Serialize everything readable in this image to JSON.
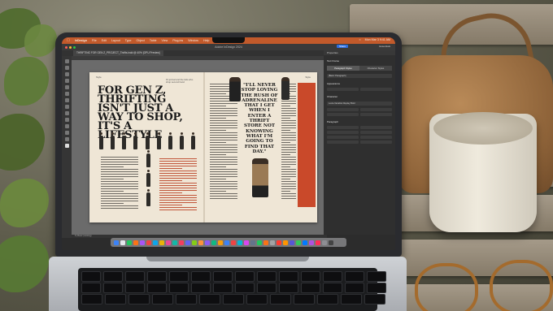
{
  "menubar": {
    "app_name": "InDesign",
    "items": [
      "File",
      "Edit",
      "Layout",
      "Type",
      "Object",
      "Table",
      "View",
      "Plug-ins",
      "Window",
      "Help"
    ],
    "status_time": "Mon Mar 3  9:41 AM"
  },
  "app": {
    "window_title": "Adobe InDesign 2024",
    "share_label": "Share",
    "workspace_label": "Essentials",
    "document_tab": "THRIFTING FOR GEN Z_PROJECT_Thrifts.indd @ 40% [GPU Preview]"
  },
  "spread": {
    "left_folio": "Style",
    "right_folio": "Style",
    "headline": "FOR GEN Z, THRIFTING ISN'T JUST A WAY TO SHOP, IT'S A LIFESTYLE",
    "byline": "Fit jotrnal and the kids who shop second hand",
    "pull_quote": "\"I'LL NEVER STOP LOVING THE RUSH OF ADRENALINE THAT I GET WHEN I ENTER A THRIFT STORE NOT KNOWING WHAT I'M GOING TO FIND THAT DAY.\""
  },
  "properties": {
    "panel_title": "Properties",
    "section_text_frame": "Text Frame",
    "tabs": [
      "Paragraph Styles",
      "Character Styles"
    ],
    "style_value": "[Basic Paragraph]",
    "section_appearance": "Appearance",
    "section_character": "Character",
    "font_value": "Lexia Variable Display Bold",
    "section_paragraph": "Paragraph"
  },
  "statusbar": {
    "page_info": "8 | Basic (working)"
  },
  "colors": {
    "menubar_bg": "#c25a2b",
    "accent_red": "#c9492a",
    "share_blue": "#2f6fe0"
  }
}
